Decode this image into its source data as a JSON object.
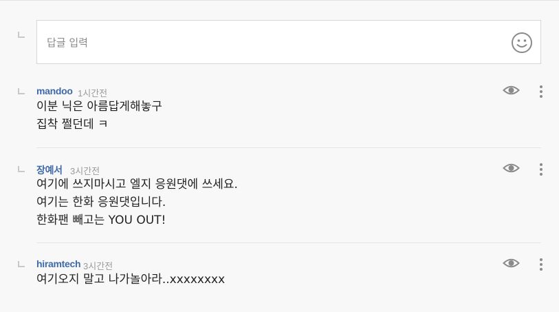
{
  "reply": {
    "placeholder": "답글 입력",
    "emoji_icon": "smiley-icon"
  },
  "comments": [
    {
      "author": "mandoo",
      "time": "1시간전",
      "lines": [
        "이분 닉은 아름답게해놓구",
        "집착 쩔던데 ㅋ"
      ]
    },
    {
      "author": "장예서",
      "time": "3시간전",
      "lines": [
        "여기에 쓰지마시고 엘지 응원댓에 쓰세요.",
        "여기는 한화 응원댓입니다.",
        "한화팬 빼고는 YOU OUT!"
      ]
    },
    {
      "author": "hiramtech",
      "time": "3시간전",
      "lines": [
        "여기오지 말고 나가놀아라..xxxxxxxx"
      ]
    }
  ],
  "icons": {
    "reply_indicator": "reply-arrow-icon",
    "view": "eye-icon",
    "more": "more-vertical-icon"
  },
  "colors": {
    "author": "#3e6aa8",
    "time": "#9a9a9a",
    "icon": "#8a8a8a",
    "background": "#f8f8f8"
  }
}
